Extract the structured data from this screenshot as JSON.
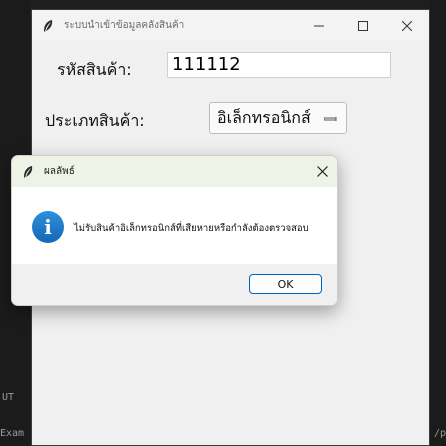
{
  "background": {
    "fragment_left_top": "UT",
    "fragment_left_bottom": "Exam",
    "fragment_right_bottom": "/p"
  },
  "window": {
    "title": "ระบบนำเข้าข้อมูลคลังสินค้า",
    "code_label": "รหัสสินค้า:",
    "code_value": "111112",
    "type_label": "ประเภทสินค้า:",
    "type_selected": "อิเล็กทรอนิกส์"
  },
  "dialog": {
    "title": "ผลลัพธ์",
    "message": "ไม่รับสินค้าอิเล็กทรอนิกส์ที่เสียหายหรือกำลังต้องตรวจสอบ",
    "ok_label": "OK",
    "icon": "info-icon"
  },
  "colors": {
    "accent": "#0067c0",
    "info_icon": "#1e7bd0"
  }
}
